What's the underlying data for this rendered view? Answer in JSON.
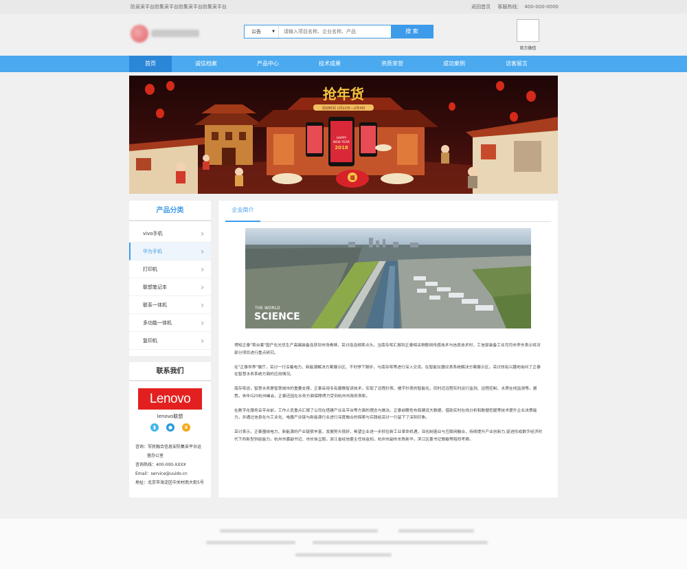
{
  "topbar": {
    "slogan": "防泉采平台防集采平台防集采平台防集采平台",
    "back_home": "返回首页",
    "hotline_label": "客服热线：",
    "hotline": "400-000-0000"
  },
  "header": {
    "search_select": "公告",
    "search_placeholder": "请输入项目名称、企业名称、产品",
    "search_button": "搜 索",
    "qr_label": "官方微信"
  },
  "nav": {
    "items": [
      "首页",
      "诚信档案",
      "产品中心",
      "技术成果",
      "资质荣誉",
      "成功案例",
      "访客留言"
    ]
  },
  "sidebar": {
    "category_title": "产品分类",
    "categories": [
      {
        "label": "vivo手机",
        "active": false
      },
      {
        "label": "华为手机",
        "active": true
      },
      {
        "label": "打印机",
        "active": false
      },
      {
        "label": "联想笔记本",
        "active": false
      },
      {
        "label": "联系一体机",
        "active": false
      },
      {
        "label": "多功能一体机",
        "active": false
      },
      {
        "label": "复印机",
        "active": false
      }
    ],
    "contact_title": "联系我们",
    "brand_logo": "Lenovo",
    "brand_name": "lenovo联想",
    "contact": {
      "consult_label": "咨询：",
      "consult_value_line1": "军民融合信息安防集采平台运",
      "consult_value_line2": "营办公室",
      "hotline_label": "咨询热线：",
      "hotline_value": "400-000-XXXX",
      "email_label": "Email：",
      "email_value": "service@uuido.cn",
      "address_label": "地址：",
      "address_value": "北京市海淀区中关村南大街5号"
    },
    "icon_colors": {
      "phone": "#3fb8e8",
      "qq": "#2a9bdc",
      "crown": "#f3a81b"
    }
  },
  "banner": {
    "title": "抢年货",
    "date_text": "活动时间  1月22日—2月4日",
    "phone_text": "HAPPY NEW YEAR 2018",
    "badge": "福"
  },
  "main": {
    "tab_label": "企业简介",
    "photo_caption_small": "THE WORLD",
    "photo_caption_big": "SCIENCE",
    "paragraphs": [
      "得知正泰\"首台套\"国产化光伏生产高端装备连获到市场青睐，茁讨连连频笑点头。当南存晖汇报到正泰相关物联网传感技术与信息技术时，工信部装备工业司司长李东表示将对部分项目进行重点研究。",
      "在\"正泰世界\"展厅，茁讨一行沿着电力、新能源解决方案展示区、不时停下脚步，与南存晖等进行深入交流。在智能仪器仪表系统解决方案展示区，茁讨饶有兴趣地询问了正泰在智慧水务系统方面的应用情况。",
      "南存晖说，智慧水务是智慧城市的重要支撑，正泰采用专有摄像智读技术，实现了远程抄表、楼宇抄表的智能化，同时还远程实时运行监测、远程控制、水质在线监测等。据悉，去年G20杭州峰会，正泰还因在水务方面保障得力受到杭州市政府表彰。",
      "在数字化服务云平台前，工作人员重点汇报了公司在搭建产业云平台等方面的理念与做法。正泰前瞻性布局建设大数据，借助实时在线分析和数据挖掘等技术提升企业决策能力，并通过信息化与工业化、电器产业链与新能源行业进行深度融合的探索与实践给茁讨一行留下了深刻印象。",
      "茁讨表示，正泰围绕电力、新能源的产业链很丰富，发展势头很好，希望企业进一步抓住新工业革命机遇，深化制造业与互联网融合，持续提升产业创新力,促进形成数字经济时代下的新型供给能力。杭州市委副书记、市长徐立毅，浙江省经信委主任徐金知，杭州市副市长陈新华，滨江区委书记詹敏等陪同考察。"
    ]
  }
}
